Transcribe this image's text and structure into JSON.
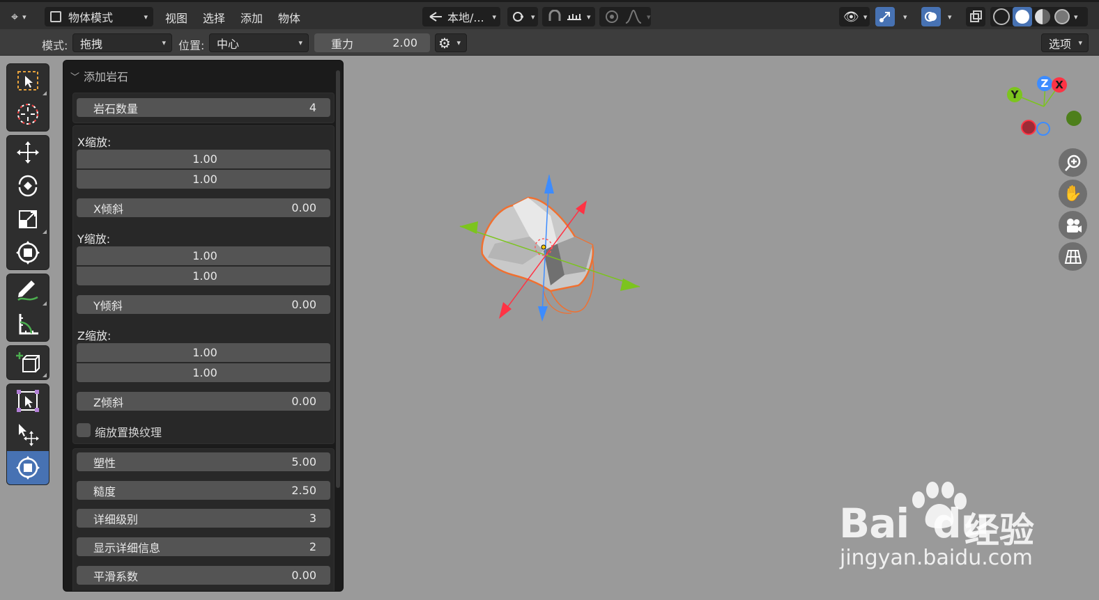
{
  "header": {
    "mode_label": "物体模式",
    "menus": [
      "视图",
      "选择",
      "添加",
      "物体"
    ],
    "transform_orientation": "本地/...",
    "colors": {
      "bg": "#303030",
      "accent": "#4772b3"
    }
  },
  "tool_settings": {
    "mode_label": "模式:",
    "mode_value": "拖拽",
    "position_label": "位置:",
    "position_value": "中心",
    "gravity_label": "重力",
    "gravity_value": "2.00",
    "options_label": "选项"
  },
  "tools": [
    "select-box-icon",
    "cursor-icon",
    "move-icon",
    "rotate-icon",
    "scale-icon",
    "transform-icon",
    "annotate-icon",
    "measure-icon",
    "add-cube-icon",
    "origin-icon",
    "move-origin-icon",
    "snap-transform-icon"
  ],
  "operator": {
    "title": "添加岩石",
    "rock_count_label": "岩石数量",
    "rock_count_value": "4",
    "x_scale_label": "X缩放:",
    "x_scale_min": "1.00",
    "x_scale_max": "1.00",
    "x_skew_label": "X倾斜",
    "x_skew_value": "0.00",
    "y_scale_label": "Y缩放:",
    "y_scale_min": "1.00",
    "y_scale_max": "1.00",
    "y_skew_label": "Y倾斜",
    "y_skew_value": "0.00",
    "z_scale_label": "Z缩放:",
    "z_scale_min": "1.00",
    "z_scale_max": "1.00",
    "z_skew_label": "Z倾斜",
    "z_skew_value": "0.00",
    "scale_texture_label": "缩放置换纹理",
    "plasticity_label": "塑性",
    "plasticity_value": "5.00",
    "roughness_label": "糙度",
    "roughness_value": "2.50",
    "detail_label": "详细级别",
    "detail_value": "3",
    "display_detail_label": "显示详细信息",
    "display_detail_value": "2",
    "smooth_label": "平滑系数",
    "smooth_value": "0.00"
  },
  "gizmo": {
    "x": "X",
    "y": "Y",
    "z": "Z"
  },
  "watermark": {
    "brand": "Bai",
    "brand_b": "du",
    "cn": "经验",
    "url": "jingyan.baidu.com"
  }
}
